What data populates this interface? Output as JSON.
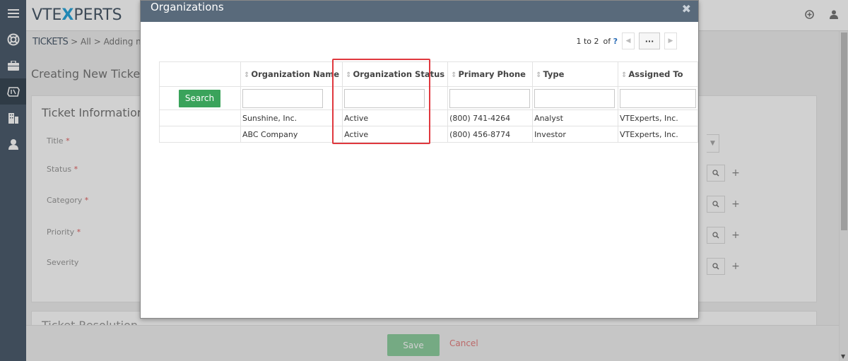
{
  "app": {
    "logo_left": "VTE",
    "logo_x": "X",
    "logo_right": "PERTS"
  },
  "breadcrumb": {
    "module": "TICKETS",
    "sep1": " > ",
    "all": "All",
    "sep2": " > ",
    "current": "Adding new"
  },
  "page": {
    "title": "Creating New Ticket",
    "section_title": "Ticket Information",
    "section2_title": "Ticket Resolution",
    "fields": [
      {
        "label": "Title",
        "required": "*"
      },
      {
        "label": "Status",
        "required": "*"
      },
      {
        "label": "Category",
        "required": "*"
      },
      {
        "label": "Priority",
        "required": "*"
      },
      {
        "label": "Severity",
        "required": ""
      }
    ]
  },
  "footer": {
    "save_label": "Save",
    "cancel_label": "Cancel"
  },
  "modal": {
    "title": "Organizations",
    "pager": {
      "range": "1 to 2",
      "of": "of",
      "total": "?",
      "dots": "···"
    },
    "search_label": "Search",
    "columns": [
      {
        "label": "Organization Name"
      },
      {
        "label": "Organization Status"
      },
      {
        "label": "Primary Phone"
      },
      {
        "label": "Type"
      },
      {
        "label": "Assigned To"
      }
    ],
    "rows": [
      {
        "name": "Sunshine, Inc.",
        "status": "Active",
        "phone": "(800) 741-4264",
        "type": "Analyst",
        "assigned": "VTExperts, Inc."
      },
      {
        "name": "ABC Company",
        "status": "Active",
        "phone": "(800) 456-8774",
        "type": "Investor",
        "assigned": "VTExperts, Inc."
      }
    ]
  },
  "icons": {
    "menu": "hamburger-menu-icon",
    "support": "lifebuoy-icon",
    "briefcase": "briefcase-icon",
    "tickets": "ticket-icon",
    "organizations": "building-icon",
    "contacts": "person-icon",
    "add": "plus-circle-icon",
    "user": "user-icon"
  },
  "colors": {
    "sidebar": "#4d5d6e",
    "modal_header": "#596a7b",
    "search_button": "#3aa35b",
    "save_button": "#8fd0a0",
    "highlight": "#e0383e",
    "cancel": "#e57f7f"
  }
}
